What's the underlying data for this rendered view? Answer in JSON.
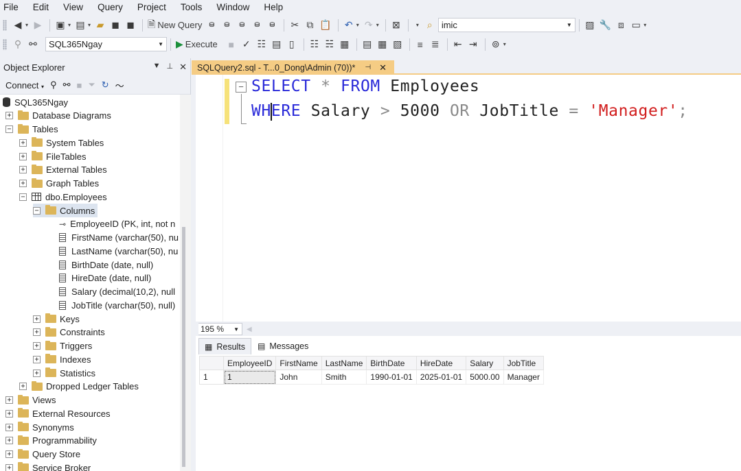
{
  "menu": [
    "File",
    "Edit",
    "View",
    "Query",
    "Project",
    "Tools",
    "Window",
    "Help"
  ],
  "toolbar1": {
    "new_query_label": "New Query",
    "search_value": "imic"
  },
  "toolbar2": {
    "database": "SQL365Ngay",
    "execute_label": "Execute"
  },
  "object_explorer": {
    "title": "Object Explorer",
    "connect_label": "Connect",
    "tree": [
      {
        "label": "SQL365Ngay",
        "indent": 0,
        "icon": "database-icon",
        "expander": ""
      },
      {
        "label": "Database Diagrams",
        "indent": 1,
        "icon": "folder-icon",
        "expander": "+"
      },
      {
        "label": "Tables",
        "indent": 1,
        "icon": "folder-icon",
        "expander": "−"
      },
      {
        "label": "System Tables",
        "indent": 2,
        "icon": "folder-icon",
        "expander": "+"
      },
      {
        "label": "FileTables",
        "indent": 2,
        "icon": "folder-icon",
        "expander": "+"
      },
      {
        "label": "External Tables",
        "indent": 2,
        "icon": "folder-icon",
        "expander": "+"
      },
      {
        "label": "Graph Tables",
        "indent": 2,
        "icon": "folder-icon",
        "expander": "+"
      },
      {
        "label": "dbo.Employees",
        "indent": 2,
        "icon": "table-icon",
        "expander": "−"
      },
      {
        "label": "Columns",
        "indent": 3,
        "icon": "folder-icon",
        "expander": "−",
        "selected": true
      },
      {
        "label": "EmployeeID (PK, int, not n",
        "indent": 4,
        "icon": "key-icon",
        "expander": ""
      },
      {
        "label": "FirstName (varchar(50), nu",
        "indent": 4,
        "icon": "column-icon",
        "expander": ""
      },
      {
        "label": "LastName (varchar(50), nu",
        "indent": 4,
        "icon": "column-icon",
        "expander": ""
      },
      {
        "label": "BirthDate (date, null)",
        "indent": 4,
        "icon": "column-icon",
        "expander": ""
      },
      {
        "label": "HireDate (date, null)",
        "indent": 4,
        "icon": "column-icon",
        "expander": ""
      },
      {
        "label": "Salary (decimal(10,2), null",
        "indent": 4,
        "icon": "column-icon",
        "expander": ""
      },
      {
        "label": "JobTitle (varchar(50), null)",
        "indent": 4,
        "icon": "column-icon",
        "expander": ""
      },
      {
        "label": "Keys",
        "indent": 3,
        "icon": "folder-icon",
        "expander": "+"
      },
      {
        "label": "Constraints",
        "indent": 3,
        "icon": "folder-icon",
        "expander": "+"
      },
      {
        "label": "Triggers",
        "indent": 3,
        "icon": "folder-icon",
        "expander": "+"
      },
      {
        "label": "Indexes",
        "indent": 3,
        "icon": "folder-icon",
        "expander": "+"
      },
      {
        "label": "Statistics",
        "indent": 3,
        "icon": "folder-icon",
        "expander": "+"
      },
      {
        "label": "Dropped Ledger Tables",
        "indent": 2,
        "icon": "folder-icon",
        "expander": "+"
      },
      {
        "label": "Views",
        "indent": 1,
        "icon": "folder-icon",
        "expander": "+"
      },
      {
        "label": "External Resources",
        "indent": 1,
        "icon": "folder-icon",
        "expander": "+"
      },
      {
        "label": "Synonyms",
        "indent": 1,
        "icon": "folder-icon",
        "expander": "+"
      },
      {
        "label": "Programmability",
        "indent": 1,
        "icon": "folder-icon",
        "expander": "+"
      },
      {
        "label": "Query Store",
        "indent": 1,
        "icon": "folder-icon",
        "expander": "+"
      },
      {
        "label": "Service Broker",
        "indent": 1,
        "icon": "folder-icon",
        "expander": "+"
      }
    ]
  },
  "document_tab": {
    "title": "SQLQuery2.sql - T...0_Dong\\Admin (70))*"
  },
  "editor": {
    "line1": [
      {
        "t": "SELECT",
        "c": "kw"
      },
      {
        "t": " ",
        "c": "plain"
      },
      {
        "t": "*",
        "c": "op"
      },
      {
        "t": " ",
        "c": "plain"
      },
      {
        "t": "FROM",
        "c": "kw"
      },
      {
        "t": " Employees",
        "c": "plain"
      }
    ],
    "line2": [
      {
        "t": "WH",
        "c": "kw"
      },
      {
        "t": "|",
        "c": "caret"
      },
      {
        "t": "ERE",
        "c": "kw"
      },
      {
        "t": " Salary ",
        "c": "plain"
      },
      {
        "t": ">",
        "c": "op"
      },
      {
        "t": " 5000 ",
        "c": "plain"
      },
      {
        "t": "OR",
        "c": "op"
      },
      {
        "t": " JobTitle ",
        "c": "plain"
      },
      {
        "t": "=",
        "c": "op"
      },
      {
        "t": " ",
        "c": "plain"
      },
      {
        "t": "'Manager'",
        "c": "str"
      },
      {
        "t": ";",
        "c": "op"
      }
    ]
  },
  "zoom": "195 %",
  "results_tabs": {
    "results": "Results",
    "messages": "Messages"
  },
  "results": {
    "columns": [
      "EmployeeID",
      "FirstName",
      "LastName",
      "BirthDate",
      "HireDate",
      "Salary",
      "JobTitle"
    ],
    "rows": [
      {
        "rownum": "1",
        "cells": [
          "1",
          "John",
          "Smith",
          "1990-01-01",
          "2025-01-01",
          "5000.00",
          "Manager"
        ]
      }
    ]
  },
  "colors": {
    "tab_accent": "#f5cc84",
    "keyword": "#2a2ad9",
    "string": "#d11d1d",
    "change_bar": "#f6e27a"
  }
}
